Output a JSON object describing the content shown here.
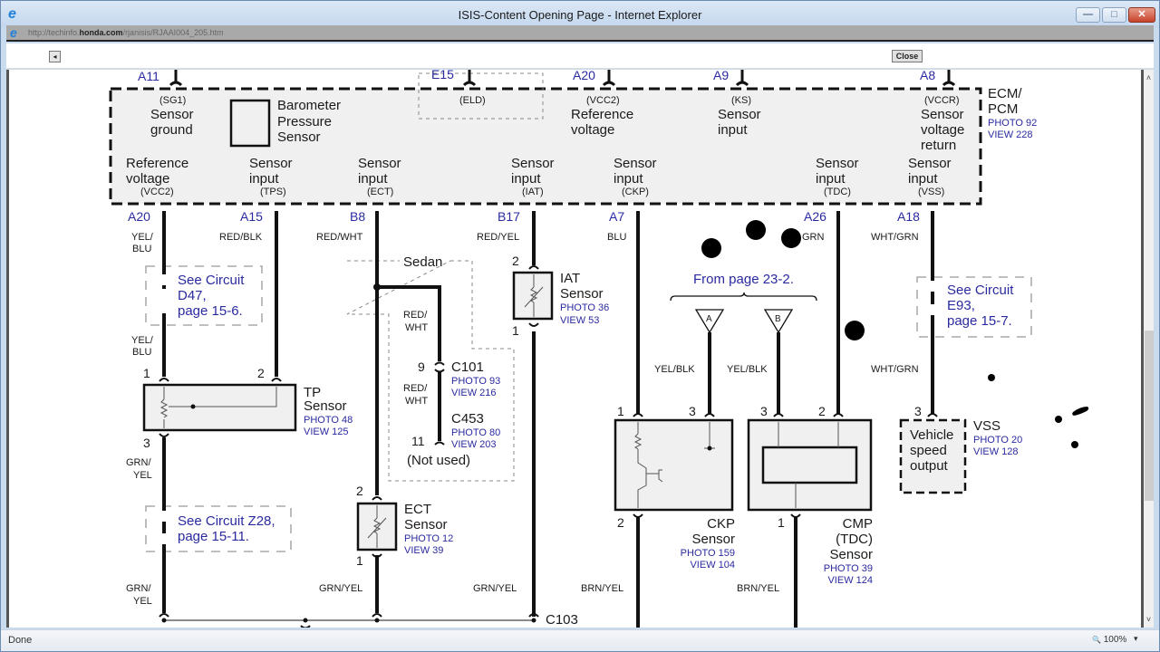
{
  "window": {
    "title": "ISIS-Content Opening Page - Internet Explorer",
    "url_prefix": "http://techinfo.",
    "url_domain": "honda.com",
    "url_path": "/rjanisis/RJAAI004_205.htm",
    "minimize_glyph": "—",
    "maximize_glyph": "□",
    "close_glyph": "✕"
  },
  "toolbar": {
    "back_glyph": "◂",
    "close_label": "Close"
  },
  "statusbar": {
    "status": "Done",
    "zoom": "100%",
    "zoom_icon": "🔍",
    "zoom_arrow": "▾"
  },
  "diagram": {
    "ecm": {
      "name_line1": "ECM/",
      "name_line2": "PCM",
      "photo": "PHOTO 92",
      "view": "VIEW 228",
      "barometer": [
        "Barometer",
        "Pressure",
        "Sensor"
      ],
      "eld": "(ELD)",
      "top_terminals": [
        {
          "pin": "A11",
          "code": "(SG1)",
          "label": [
            "Sensor",
            "ground"
          ]
        },
        {
          "pin": "E15",
          "code": "(ELD)",
          "label": []
        },
        {
          "pin": "A20",
          "code": "(VCC2)",
          "label": [
            "Reference",
            "voltage"
          ]
        },
        {
          "pin": "A9",
          "code": "(KS)",
          "label": [
            "Sensor",
            "input"
          ]
        },
        {
          "pin": "A8",
          "code": "(VCCR)",
          "label": [
            "Sensor",
            "voltage",
            "return"
          ]
        }
      ],
      "bottom_terminals": [
        {
          "pin": "A20",
          "code": "(VCC2)",
          "label": [
            "Reference",
            "voltage"
          ],
          "wire": "YEL/ BLU"
        },
        {
          "pin": "A15",
          "code": "(TPS)",
          "label": [
            "Sensor",
            "input"
          ],
          "wire": "RED/BLK"
        },
        {
          "pin": "B8",
          "code": "(ECT)",
          "label": [
            "Sensor",
            "input"
          ],
          "wire": "RED/WHT"
        },
        {
          "pin": "B17",
          "code": "(IAT)",
          "label": [
            "Sensor",
            "input"
          ],
          "wire": "RED/YEL"
        },
        {
          "pin": "A7",
          "code": "(CKP)",
          "label": [
            "Sensor",
            "input"
          ],
          "wire": "BLU"
        },
        {
          "pin": "A26",
          "code": "(TDC)",
          "label": [
            "Sensor",
            "input"
          ],
          "wire": "GRN"
        },
        {
          "pin": "A18",
          "code": "(VSS)",
          "label": [
            "Sensor",
            "input"
          ],
          "wire": "WHT/GRN"
        }
      ]
    },
    "wires": {
      "yel_blu_1": "YEL/",
      "yel_blu_2": "BLU",
      "red_blk": "RED/BLK",
      "red_wht": "RED/WHT",
      "red_yel": "RED/YEL",
      "blu": "BLU",
      "grn": "GRN",
      "wht_grn": "WHT/GRN",
      "red_wht_1": "RED/",
      "red_wht_2": "WHT",
      "yel_blk": "YEL/BLK",
      "grn_yel": "GRN/YEL",
      "grn_yel_1": "GRN/",
      "grn_yel_2": "YEL",
      "brn_yel": "BRN/YEL"
    },
    "references": {
      "d47": [
        "See Circuit",
        "D47,",
        "page 15-6."
      ],
      "e93": [
        "See Circuit",
        "E93,",
        "page 15-7."
      ],
      "z28": [
        "See Circuit Z28,",
        "page 15-11."
      ],
      "from_page": "From page 23-2.",
      "sedan": "Sedan"
    },
    "connectors": {
      "c101": {
        "name": "C101",
        "photo": "PHOTO 93",
        "view": "VIEW 216",
        "pin": "9"
      },
      "c453": {
        "name": "C453",
        "photo": "PHOTO 80",
        "view": "VIEW 203",
        "pin": "11"
      },
      "not_used": "(Not used)",
      "c103": "C103",
      "tri_a": "A",
      "tri_b": "B"
    },
    "sensors": {
      "tp": {
        "name": "TP",
        "sub": "Sensor",
        "photo": "PHOTO 48",
        "view": "VIEW 125",
        "pins": [
          "1",
          "2",
          "3"
        ]
      },
      "iat": {
        "name": "IAT",
        "sub": "Sensor",
        "photo": "PHOTO 36",
        "view": "VIEW 53",
        "pins": [
          "2",
          "1"
        ]
      },
      "ect": {
        "name": "ECT",
        "sub": "Sensor",
        "photo": "PHOTO 12",
        "view": "VIEW 39",
        "pins": [
          "2",
          "1"
        ]
      },
      "ckp": {
        "name": "CKP",
        "sub": "Sensor",
        "photo": "PHOTO 159",
        "view": "VIEW 104",
        "pins": [
          "1",
          "3",
          "2"
        ]
      },
      "cmp": {
        "name": "CMP",
        "name2": "(TDC)",
        "sub": "Sensor",
        "photo": "PHOTO 39",
        "view": "VIEW 124",
        "pins": [
          "3",
          "2",
          "1"
        ]
      },
      "vss": {
        "name": "VSS",
        "photo": "PHOTO 20",
        "view": "VIEW 128",
        "box": [
          "Vehicle",
          "speed",
          "output"
        ],
        "pin": "3"
      }
    }
  }
}
